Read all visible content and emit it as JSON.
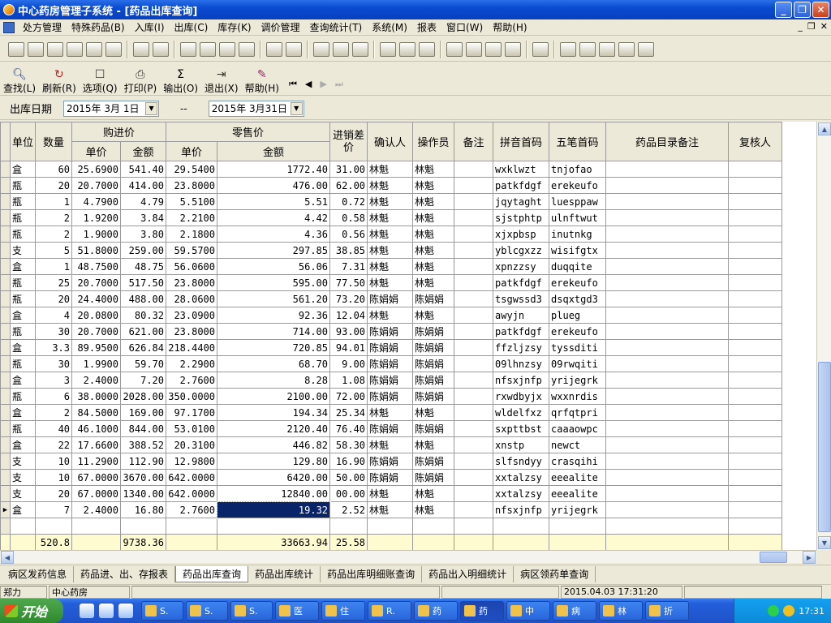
{
  "window": {
    "title": "中心药房管理子系统 - [药品出库查询]"
  },
  "menu": [
    "处方管理",
    "特殊药品(B)",
    "入库(I)",
    "出库(C)",
    "库存(K)",
    "调价管理",
    "查询统计(T)",
    "系统(M)",
    "报表",
    "窗口(W)",
    "帮助(H)"
  ],
  "toolbar": {
    "find": "查找(L)",
    "refresh": "刷新(R)",
    "options": "选项(Q)",
    "print": "打印(P)",
    "export": "输出(O)",
    "exit": "退出(X)",
    "help": "帮助(H)"
  },
  "filter": {
    "label": "出库日期",
    "start": "2015年 3月 1日",
    "sep": "--",
    "end": "2015年 3月31日"
  },
  "table": {
    "headers": {
      "unit": "单位",
      "qty": "数量",
      "purchase": "购进价",
      "retail": "零售价",
      "price": "单价",
      "amount": "金额",
      "diff": "进销差价",
      "confirmer": "确认人",
      "operator": "操作员",
      "note": "备注",
      "pinyin": "拼音首码",
      "wubi": "五笔首码",
      "catalog_note": "药品目录备注",
      "reviewer": "复核人"
    },
    "rows": [
      [
        "盒",
        "60",
        "25.6900",
        "541.40",
        "29.5400",
        "1772.40",
        "31.00",
        "林魁",
        "林魁",
        "",
        "wxklwzt",
        "tnjofao",
        "",
        ""
      ],
      [
        "瓶",
        "20",
        "20.7000",
        "414.00",
        "23.8000",
        "476.00",
        "62.00",
        "林魁",
        "林魁",
        "",
        "patkfdgf",
        "erekeufo",
        "",
        ""
      ],
      [
        "瓶",
        "1",
        "4.7900",
        "4.79",
        "5.5100",
        "5.51",
        "0.72",
        "林魁",
        "林魁",
        "",
        "jqytaght",
        "luesppaw",
        "",
        ""
      ],
      [
        "瓶",
        "2",
        "1.9200",
        "3.84",
        "2.2100",
        "4.42",
        "0.58",
        "林魁",
        "林魁",
        "",
        "sjstphtp",
        "ulnftwut",
        "",
        ""
      ],
      [
        "瓶",
        "2",
        "1.9000",
        "3.80",
        "2.1800",
        "4.36",
        "0.56",
        "林魁",
        "林魁",
        "",
        "xjxpbsp",
        "inutnkg",
        "",
        ""
      ],
      [
        "支",
        "5",
        "51.8000",
        "259.00",
        "59.5700",
        "297.85",
        "38.85",
        "林魁",
        "林魁",
        "",
        "yblcgxzz",
        "wisifgtx",
        "",
        ""
      ],
      [
        "盒",
        "1",
        "48.7500",
        "48.75",
        "56.0600",
        "56.06",
        "7.31",
        "林魁",
        "林魁",
        "",
        "xpnzzsy",
        "duqqite",
        "",
        ""
      ],
      [
        "瓶",
        "25",
        "20.7000",
        "517.50",
        "23.8000",
        "595.00",
        "77.50",
        "林魁",
        "林魁",
        "",
        "patkfdgf",
        "erekeufo",
        "",
        ""
      ],
      [
        "瓶",
        "20",
        "24.4000",
        "488.00",
        "28.0600",
        "561.20",
        "73.20",
        "陈娟娟",
        "陈娟娟",
        "",
        "tsgwssd3",
        "dsqxtgd3",
        "",
        ""
      ],
      [
        "盒",
        "4",
        "20.0800",
        "80.32",
        "23.0900",
        "92.36",
        "12.04",
        "林魁",
        "林魁",
        "",
        "awyjn",
        "plueg",
        "",
        ""
      ],
      [
        "瓶",
        "30",
        "20.7000",
        "621.00",
        "23.8000",
        "714.00",
        "93.00",
        "陈娟娟",
        "陈娟娟",
        "",
        "patkfdgf",
        "erekeufo",
        "",
        ""
      ],
      [
        "盒",
        "3.3",
        "89.9500",
        "626.84",
        "218.4400",
        "720.85",
        "94.01",
        "陈娟娟",
        "陈娟娟",
        "",
        "ffzljzsy",
        "tyssditi",
        "",
        ""
      ],
      [
        "瓶",
        "30",
        "1.9900",
        "59.70",
        "2.2900",
        "68.70",
        "9.00",
        "陈娟娟",
        "陈娟娟",
        "",
        "09lhnzsy",
        "09rwqiti",
        "",
        ""
      ],
      [
        "盒",
        "3",
        "2.4000",
        "7.20",
        "2.7600",
        "8.28",
        "1.08",
        "陈娟娟",
        "陈娟娟",
        "",
        "nfsxjnfp",
        "yrijegrk",
        "",
        ""
      ],
      [
        "瓶",
        "6",
        "38.0000",
        "2028.00",
        "350.0000",
        "2100.00",
        "72.00",
        "陈娟娟",
        "陈娟娟",
        "",
        "rxwdbyjx",
        "wxxnrdis",
        "",
        ""
      ],
      [
        "盒",
        "2",
        "84.5000",
        "169.00",
        "97.1700",
        "194.34",
        "25.34",
        "林魁",
        "林魁",
        "",
        "wldelfxz",
        "qrfqtpri",
        "",
        ""
      ],
      [
        "瓶",
        "40",
        "46.1000",
        "844.00",
        "53.0100",
        "2120.40",
        "76.40",
        "陈娟娟",
        "陈娟娟",
        "",
        "sxpttbst",
        "caaaowpc",
        "",
        ""
      ],
      [
        "盒",
        "22",
        "17.6600",
        "388.52",
        "20.3100",
        "446.82",
        "58.30",
        "林魁",
        "林魁",
        "",
        "xnstp",
        "newct",
        "",
        ""
      ],
      [
        "支",
        "10",
        "11.2900",
        "112.90",
        "12.9800",
        "129.80",
        "16.90",
        "陈娟娟",
        "陈娟娟",
        "",
        "slfsndyy",
        "crasqihi",
        "",
        ""
      ],
      [
        "支",
        "10",
        "67.0000",
        "3670.00",
        "642.0000",
        "6420.00",
        "50.00",
        "陈娟娟",
        "陈娟娟",
        "",
        "xxtalzsy",
        "eeealite",
        "",
        ""
      ],
      [
        "支",
        "20",
        "67.0000",
        "1340.00",
        "642.0000",
        "12840.00",
        "00.00",
        "林魁",
        "林魁",
        "",
        "xxtalzsy",
        "eeealite",
        "",
        ""
      ],
      [
        "盒",
        "7",
        "2.4000",
        "16.80",
        "2.7600",
        "19.32",
        "2.52",
        "林魁",
        "林魁",
        "",
        "nfsxjnfp",
        "yrijegrk",
        "",
        ""
      ]
    ],
    "totals": {
      "qty": "520.8",
      "purchase_amount": "9738.36",
      "retail_amount": "33663.94",
      "diff": "25.58"
    }
  },
  "tabs": [
    "病区发药信息",
    "药品进、出、存报表",
    "药品出库查询",
    "药品出库统计",
    "药品出库明细账查询",
    "药品出入明细统计",
    "病区领药单查询"
  ],
  "status": {
    "user": "郑力",
    "dept": "中心药房",
    "datetime": "2015.04.03 17:31:20"
  },
  "taskbar": {
    "start": "开始",
    "tasks": [
      "S.",
      "S.",
      "S.",
      "医",
      "住",
      "R.",
      "药",
      "药",
      "中",
      "病",
      "林",
      "折"
    ],
    "clock": "17:31"
  }
}
